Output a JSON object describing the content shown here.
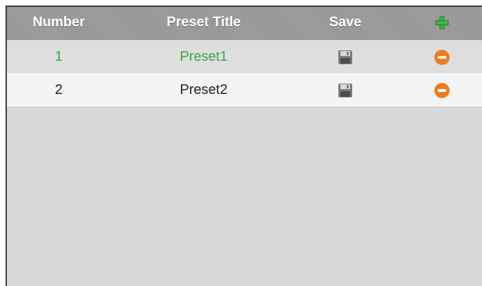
{
  "header": {
    "number_label": "Number",
    "title_label": "Preset Title",
    "save_label": "Save",
    "add_icon": "plus-icon"
  },
  "presets": [
    {
      "number": "1",
      "title": "Preset1",
      "save_icon": "floppy-disk-icon",
      "delete_icon": "minus-circle-icon",
      "active": true
    },
    {
      "number": "2",
      "title": "Preset2",
      "save_icon": "floppy-disk-icon",
      "delete_icon": "minus-circle-icon",
      "active": false
    }
  ],
  "colors": {
    "active_text": "#3aa54a",
    "normal_text": "#222222",
    "delete_icon": "#f07a1e",
    "add_icon": "#3cb54a"
  }
}
